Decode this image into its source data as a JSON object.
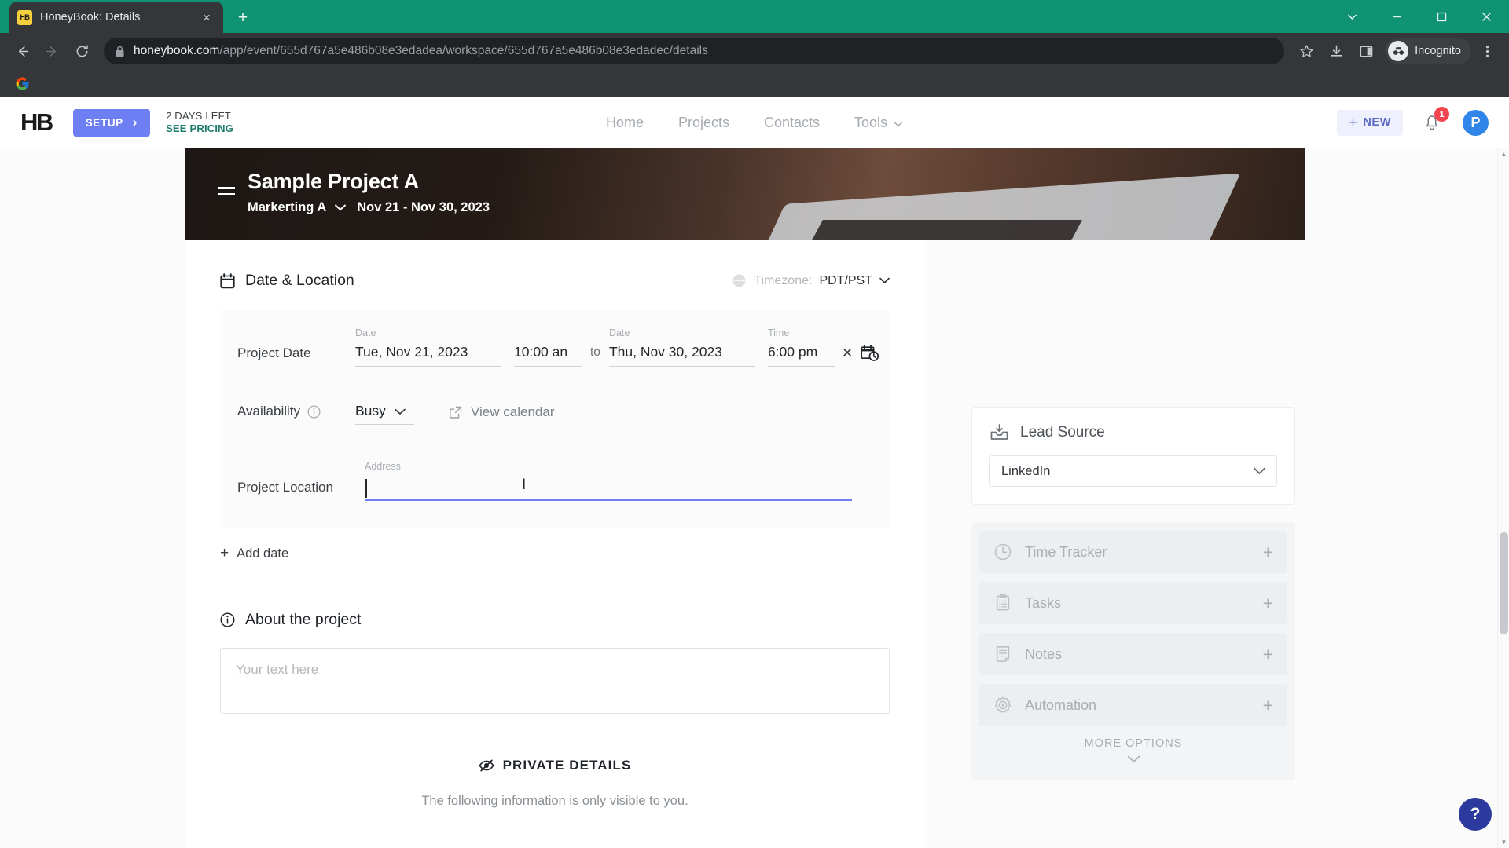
{
  "browser": {
    "tab": {
      "title": "HoneyBook: Details",
      "favicon_text": "HB",
      "close_label": "×"
    },
    "new_tab_label": "+",
    "window": {
      "minimize": "—",
      "maximize": "□",
      "close": "✕",
      "chevron": "⌄"
    },
    "nav": {
      "back": "back-arrow",
      "forward": "forward-arrow",
      "reload": "reload-icon"
    },
    "omnibox": {
      "lock_icon": "lock-icon",
      "url_domain": "honeybook.com",
      "url_path": "/app/event/655d767a5e486b08e3edadea/workspace/655d767a5e486b08e3edadec/details",
      "url_full": "honeybook.com/app/event/655d767a5e486b08e3edadea/workspace/655d767a5e486b08e3edadec/details"
    },
    "toolbar_icons": [
      "bookmark-star-icon",
      "download-icon",
      "side-panel-icon"
    ],
    "incognito_label": "Incognito",
    "menu_icon": "three-dot-menu-icon",
    "bookmarks": [
      {
        "name": "google-bookmark",
        "label": ""
      }
    ]
  },
  "topnav": {
    "logo": "HB",
    "setup_label": "SETUP",
    "setup_chevron": "›",
    "trial_days": "2 DAYS LEFT",
    "trial_pricing": "SEE PRICING",
    "links": [
      {
        "label": "Home",
        "caret": false
      },
      {
        "label": "Projects",
        "caret": false
      },
      {
        "label": "Contacts",
        "caret": false
      },
      {
        "label": "Tools",
        "caret": true
      }
    ],
    "new_button": "NEW",
    "new_plus": "+",
    "notification_count": "1",
    "avatar_initial": "P"
  },
  "hero": {
    "menu_icon": "hamburger-menu-icon",
    "project_title": "Sample Project A",
    "project_type": "Markerting A",
    "date_range": "Nov 21 - Nov 30, 2023"
  },
  "details": {
    "section_title": "Date & Location",
    "section_icon": "calendar-icon",
    "timezone_icon": "globe-icon",
    "timezone_label": "Timezone:",
    "timezone_value": "PDT/PST",
    "project_date_label": "Project Date",
    "start_date_caption": "Date",
    "start_date_value": "Tue, Nov 21, 2023",
    "start_time_caption": "",
    "start_time_value": "10:00 an",
    "to_word": "to",
    "end_date_caption": "Date",
    "end_date_value": "Thu, Nov 30, 2023",
    "end_time_caption": "Time",
    "end_time_value": "6:00 pm",
    "clear_label": "✕",
    "recurring_icon": "calendar-clock-icon",
    "availability_label": "Availability",
    "availability_info_icon": "info-icon",
    "availability_value": "Busy",
    "view_calendar_label": "View calendar",
    "view_calendar_icon": "external-link-icon",
    "project_location_label": "Project Location",
    "address_caption": "Address",
    "address_value": "",
    "add_date_label": "Add date",
    "add_date_plus": "+"
  },
  "about": {
    "title": "About the project",
    "icon": "info-icon",
    "placeholder": "Your text here",
    "value": ""
  },
  "private": {
    "icon": "eye-slash-icon",
    "title": "PRIVATE DETAILS",
    "note": "The following information is only visible to you."
  },
  "sidebar": {
    "lead_source": {
      "icon": "inbox-download-icon",
      "title": "Lead Source",
      "selected": "LinkedIn",
      "chevron": "chevron-down-icon"
    },
    "items": [
      {
        "label": "Time Tracker",
        "icon": "clock-icon",
        "action": "+"
      },
      {
        "label": "Tasks",
        "icon": "clipboard-icon",
        "action": "+"
      },
      {
        "label": "Notes",
        "icon": "note-icon",
        "action": "+"
      },
      {
        "label": "Automation",
        "icon": "automation-gear-icon",
        "action": "+"
      }
    ],
    "more_options": "MORE OPTIONS",
    "more_chevron": "chevron-down-icon"
  },
  "help": {
    "label": "?"
  },
  "colors": {
    "incognito_green": "#0f9372",
    "accent_blue": "#6e7ff3",
    "badge_red": "#f2454f",
    "avatar_blue": "#2f86e8",
    "help_blue": "#2b3a9c",
    "pricing_teal": "#1d7b6a"
  }
}
